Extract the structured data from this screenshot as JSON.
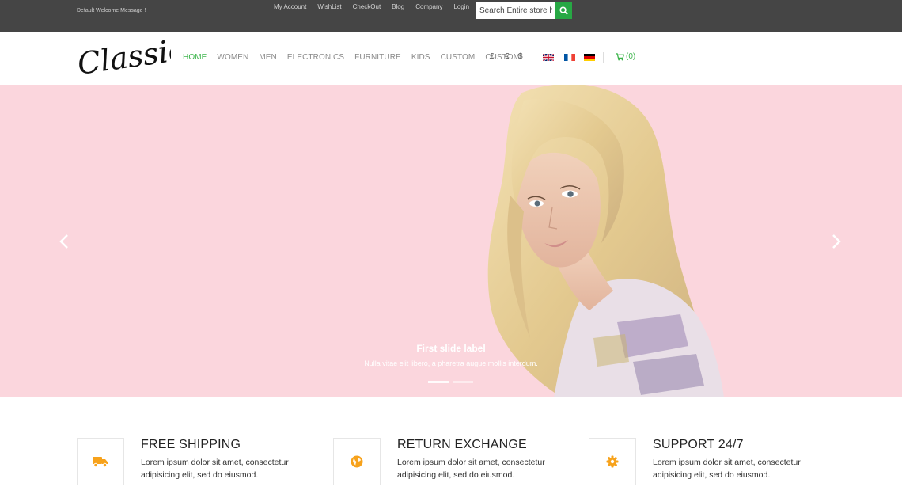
{
  "topbar": {
    "welcome": "Default Welcome Message !",
    "links": [
      "My Account",
      "WishList",
      "CheckOut",
      "Blog",
      "Company",
      "Login"
    ],
    "search_placeholder": "Search Entire store here..."
  },
  "header": {
    "logo_text": "Classic",
    "nav": [
      "HOME",
      "WOMEN",
      "MEN",
      "ELECTRONICS",
      "FURNITURE",
      "KIDS",
      "CUSTOM",
      "CUSTOM"
    ],
    "currencies": [
      "£",
      "€",
      "$"
    ],
    "flags": [
      "uk-flag",
      "france-flag",
      "germany-flag"
    ],
    "cart_label": "(0)"
  },
  "slider": {
    "caption_title": "First slide label",
    "caption_text": "Nulla vitae elit libero, a pharetra augue mollis interdum."
  },
  "features": [
    {
      "title": "FREE SHIPPING",
      "text": "Lorem ipsum dolor sit amet, consectetur adipisicing elit, sed do eiusmod.",
      "icon": "truck-icon"
    },
    {
      "title": "RETURN EXCHANGE",
      "text": "Lorem ipsum dolor sit amet, consectetur adipisicing elit, sed do eiusmod.",
      "icon": "globe-icon"
    },
    {
      "title": "SUPPORT 24/7",
      "text": "Lorem ipsum dolor sit amet, consectetur adipisicing elit, sed do eiusmod.",
      "icon": "gear-icon"
    }
  ],
  "colors": {
    "topbar_bg": "#454545",
    "accent_green": "#3cb54b",
    "slider_bg": "#fbd6dd",
    "icon_orange": "#f7a21b"
  }
}
